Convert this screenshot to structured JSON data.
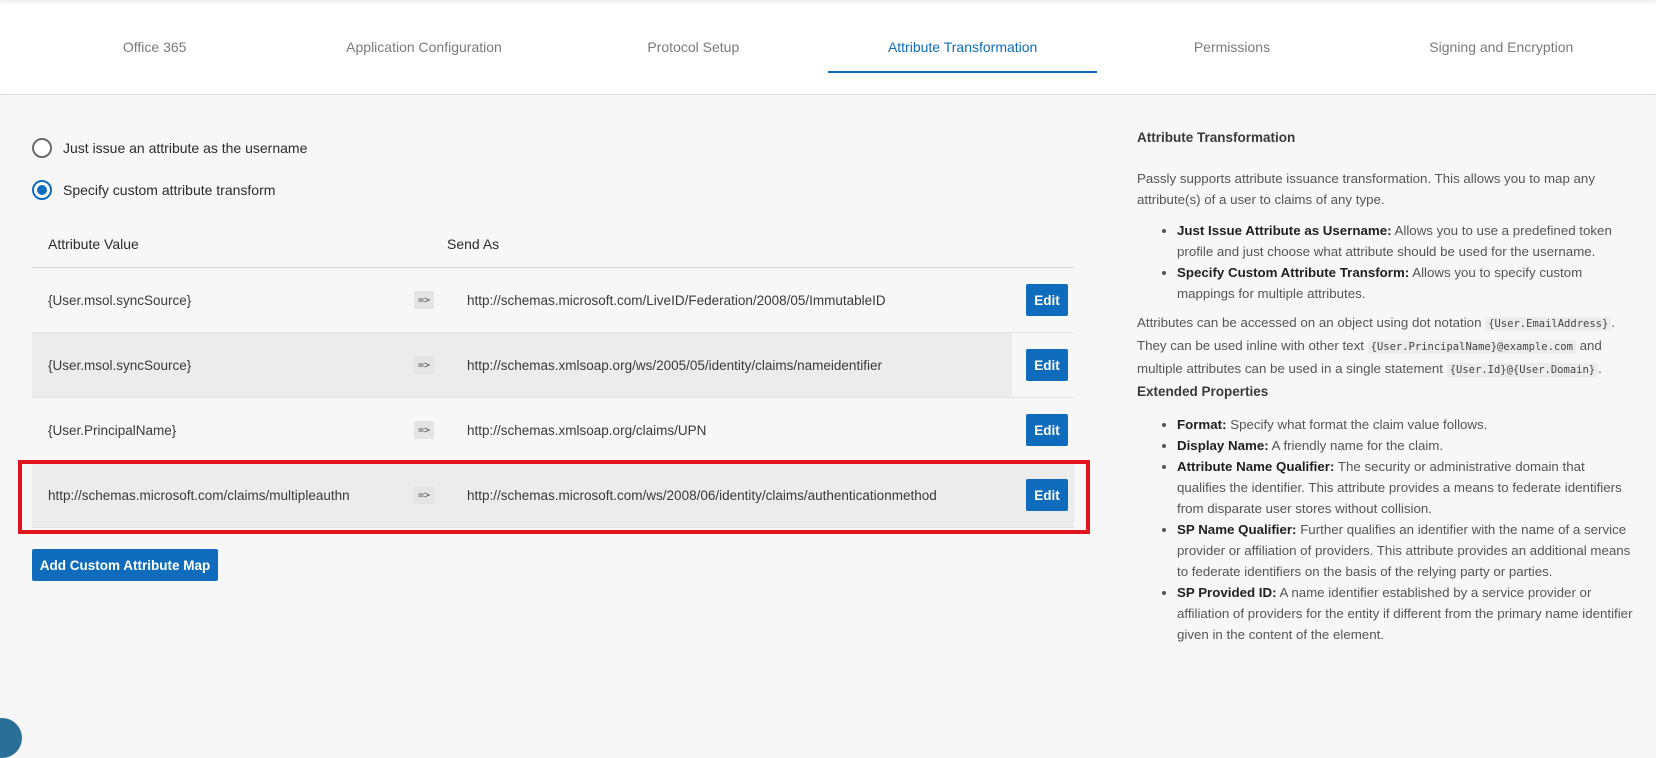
{
  "tabs": [
    {
      "label": "Office 365"
    },
    {
      "label": "Application Configuration"
    },
    {
      "label": "Protocol Setup"
    },
    {
      "label": "Attribute Transformation",
      "active": true
    },
    {
      "label": "Permissions"
    },
    {
      "label": "Signing and Encryption"
    }
  ],
  "options": {
    "just_issue_label": "Just issue an attribute as the username",
    "custom_transform_label": "Specify custom attribute transform",
    "selected": "custom"
  },
  "table": {
    "col_value": "Attribute Value",
    "col_send": "Send As",
    "rows": [
      {
        "value": "{User.msol.syncSource}",
        "arrow": "=>",
        "send_as": "http://schemas.microsoft.com/LiveID/Federation/2008/05/ImmutableID",
        "edit": "Edit"
      },
      {
        "value": "{User.msol.syncSource}",
        "arrow": "=>",
        "send_as": "http://schemas.xmlsoap.org/ws/2005/05/identity/claims/nameidentifier",
        "edit": "Edit"
      },
      {
        "value": "{User.PrincipalName}",
        "arrow": "=>",
        "send_as": "http://schemas.xmlsoap.org/claims/UPN",
        "edit": "Edit"
      },
      {
        "value": "http://schemas.microsoft.com/claims/multipleauthn",
        "arrow": "=>",
        "send_as": "http://schemas.microsoft.com/ws/2008/06/identity/claims/authenticationmethod",
        "edit": "Edit"
      }
    ],
    "add_label": "Add Custom Attribute Map"
  },
  "help": {
    "title": "Attribute Transformation",
    "intro": "Passly supports attribute issuance transformation. This allows you to map any attribute(s) of a user to claims of any type.",
    "modes": [
      {
        "term": "Just Issue Attribute as Username:",
        "desc": "Allows you to use a predefined token profile and just choose what attribute should be used for the username."
      },
      {
        "term": "Specify Custom Attribute Transform:",
        "desc": "Allows you to specify custom mappings for multiple attributes."
      }
    ],
    "notation_1": "Attributes can be accessed on an object using dot notation",
    "code_1": "{User.EmailAddress}",
    "notation_2": ". They can be used inline with other text",
    "code_2": "{User.PrincipalName}@example.com",
    "notation_3": "and multiple attributes can be used in a single statement",
    "code_3": "{User.Id}@{User.Domain}",
    "notation_4": ".",
    "ext_title": "Extended Properties",
    "ext_items": [
      {
        "term": "Format:",
        "desc": "Specify what format the claim value follows."
      },
      {
        "term": "Display Name:",
        "desc": "A friendly name for the claim."
      },
      {
        "term": "Attribute Name Qualifier:",
        "desc": "The security or administrative domain that qualifies the identifier. This attribute provides a means to federate identifiers from disparate user stores without collision."
      },
      {
        "term": "SP Name Qualifier:",
        "desc": "Further qualifies an identifier with the name of a service provider or affiliation of providers. This attribute provides an additional means to federate identifiers on the basis of the relying party or parties."
      },
      {
        "term": "SP Provided ID:",
        "desc": "A name identifier established by a service provider or affiliation of providers for the entity if different from the primary name identifier given in the content of the element."
      }
    ]
  },
  "colors": {
    "accent": "#0f6cbd",
    "highlight": "#e0141e"
  }
}
